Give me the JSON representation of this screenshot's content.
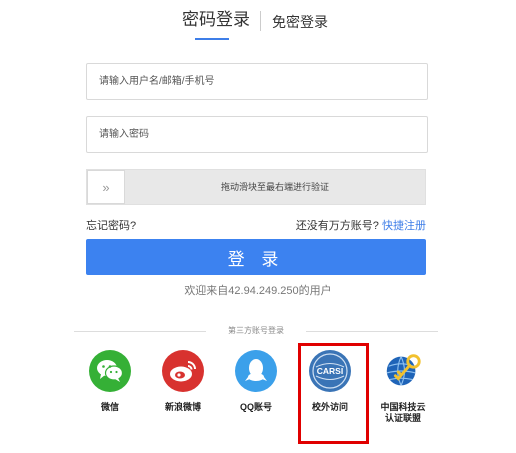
{
  "tabs": {
    "password_login": "密码登录",
    "passwordless_login": "免密登录"
  },
  "form": {
    "username_placeholder": "请输入用户名/邮箱/手机号",
    "password_placeholder": "请输入密码",
    "slider_handle": "»",
    "slider_text": "拖动滑块至最右端进行验证",
    "forgot_password": "忘记密码?",
    "no_account_text": "还没有万方账号?",
    "register_link": "快捷注册",
    "login_button": "登 录",
    "welcome_text": "欢迎来自42.94.249.250的用户"
  },
  "third_party": {
    "title": "第三方账号登录",
    "providers": [
      {
        "label": "微信",
        "icon": "wechat-icon",
        "color": "#35b036"
      },
      {
        "label": "新浪微博",
        "icon": "weibo-icon",
        "color": "#d8322f"
      },
      {
        "label": "QQ账号",
        "icon": "qq-icon",
        "color": "#3ba0ea"
      },
      {
        "label": "校外访问",
        "icon": "carsi-icon",
        "color": "#3a74b6",
        "icon_text": "CARSI"
      },
      {
        "label": "中国科技云\n认证联盟",
        "icon": "cstcloud-icon",
        "color": "#1f64b8"
      }
    ]
  },
  "colors": {
    "accent": "#3c82f0",
    "link": "#3e7ee8",
    "highlight_border": "#e00000"
  }
}
